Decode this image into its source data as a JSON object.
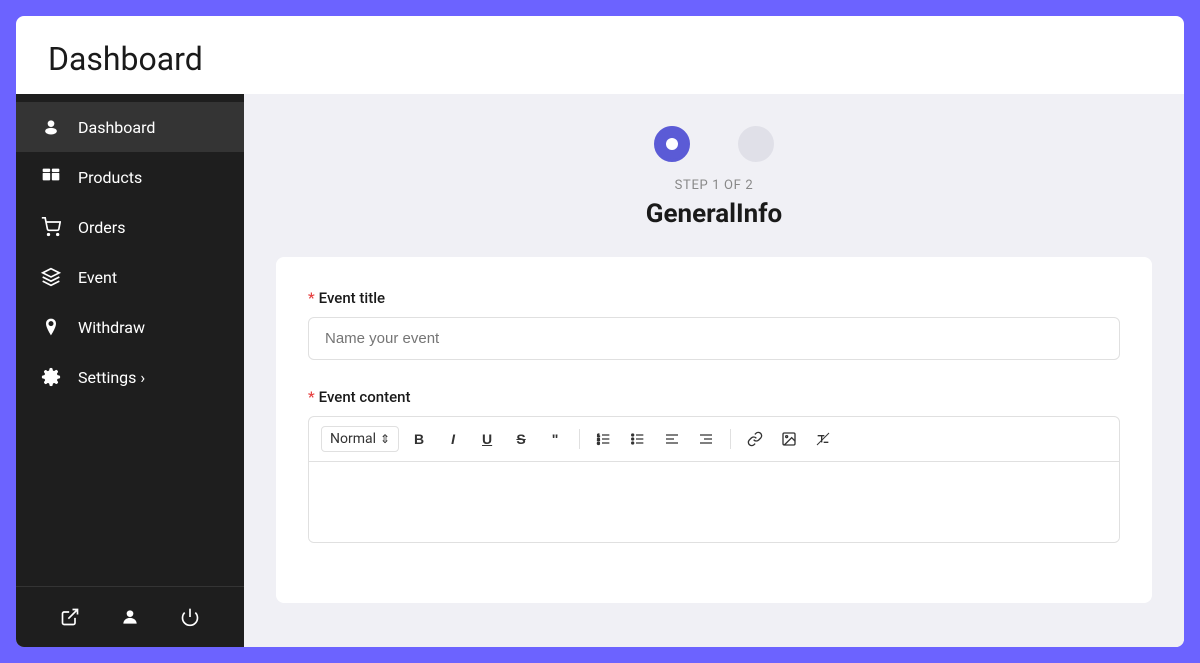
{
  "page": {
    "title": "Dashboard",
    "background_color": "#6c63ff"
  },
  "sidebar": {
    "items": [
      {
        "id": "dashboard",
        "label": "Dashboard",
        "icon": "dashboard-icon",
        "active": true
      },
      {
        "id": "products",
        "label": "Products",
        "icon": "products-icon",
        "active": false
      },
      {
        "id": "orders",
        "label": "Orders",
        "icon": "orders-icon",
        "active": false
      },
      {
        "id": "event",
        "label": "Event",
        "icon": "event-icon",
        "active": false
      },
      {
        "id": "withdraw",
        "label": "Withdraw",
        "icon": "withdraw-icon",
        "active": false
      },
      {
        "id": "settings",
        "label": "Settings ›",
        "icon": "settings-icon",
        "active": false
      }
    ],
    "bottom_icons": [
      "external-link-icon",
      "user-icon",
      "power-icon"
    ]
  },
  "steps": {
    "label": "STEP 1 OF 2",
    "title": "GeneralInfo",
    "step1_active": true,
    "step2_active": false
  },
  "form": {
    "event_title_label": "Event title",
    "event_title_placeholder": "Name your event",
    "event_content_label": "Event content",
    "toolbar": {
      "format_label": "Normal",
      "buttons": [
        "B",
        "I",
        "U",
        "S",
        "❝",
        "|",
        "ol",
        "ul",
        "align-left",
        "align-right",
        "|",
        "link",
        "image",
        "clear"
      ]
    }
  }
}
